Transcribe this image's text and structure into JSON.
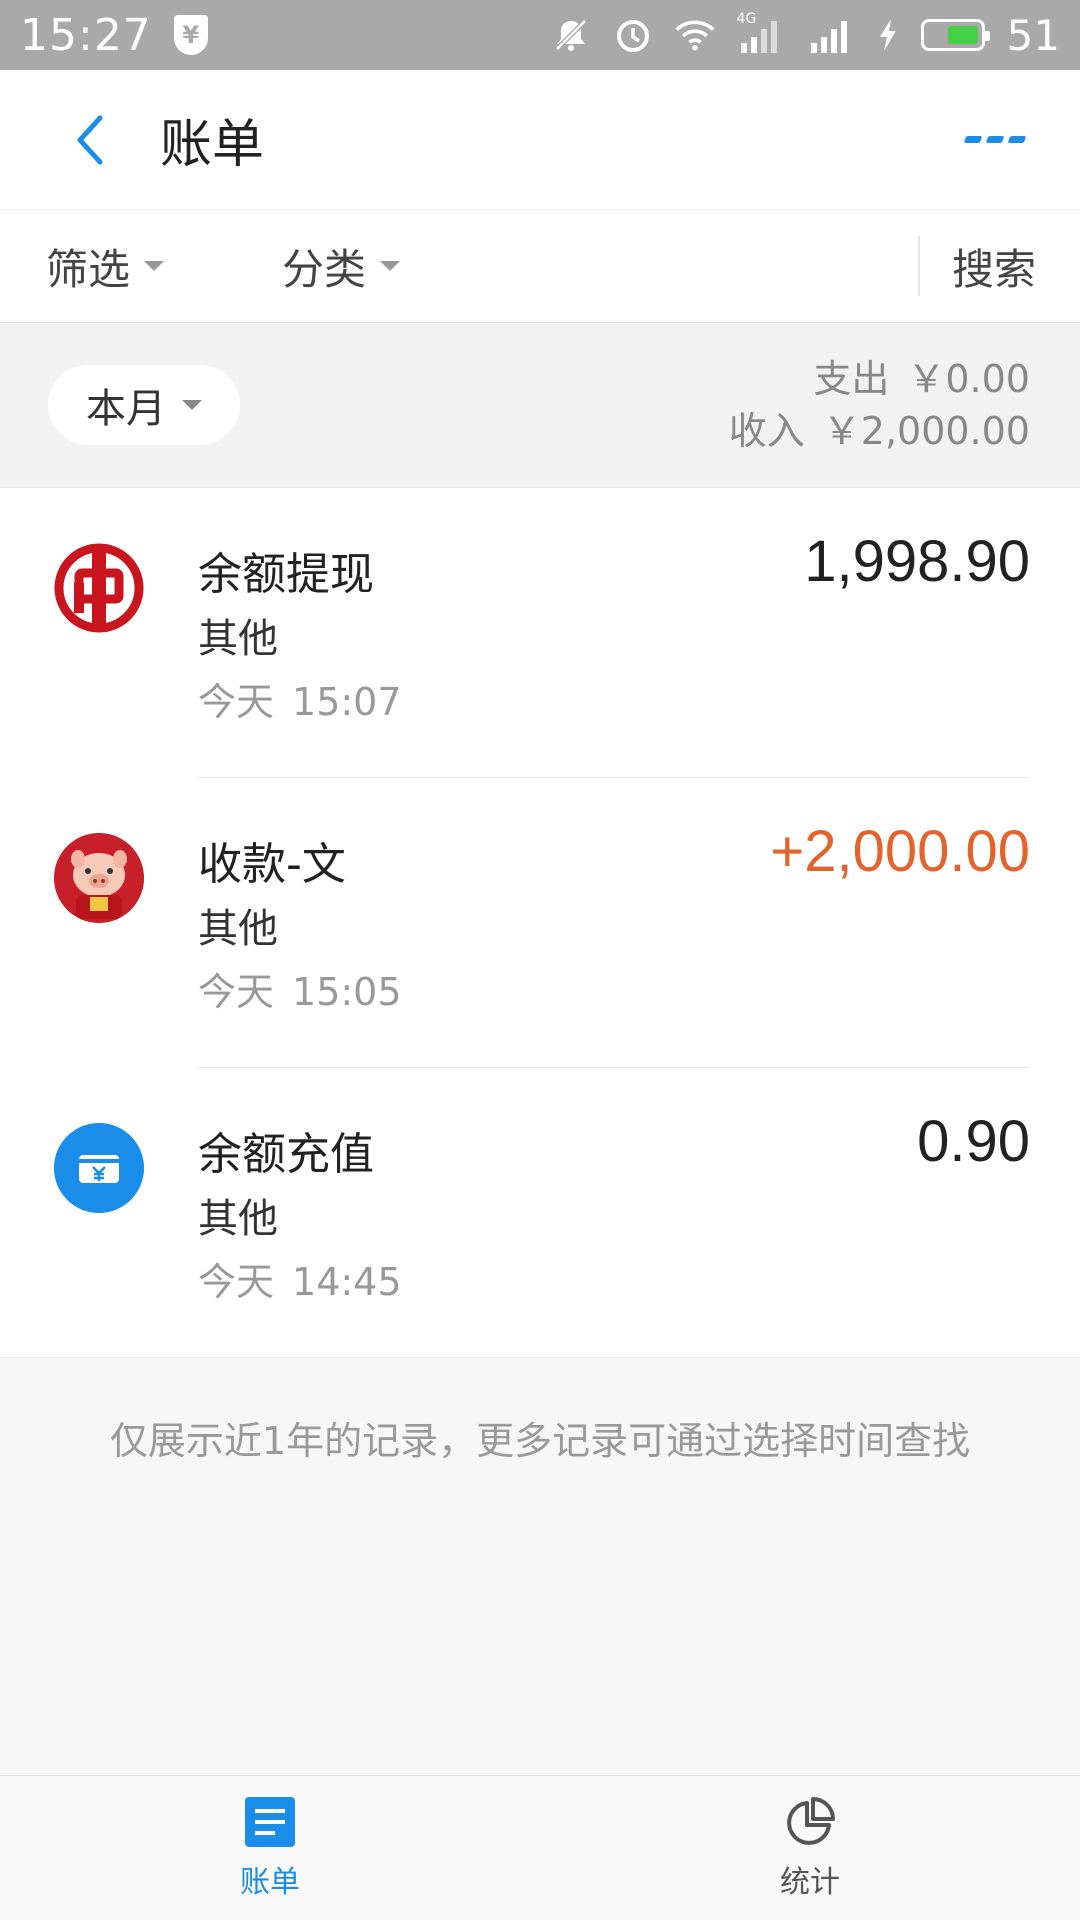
{
  "status_bar": {
    "time": "15:27",
    "shield_glyph": "¥",
    "network_type": "4G",
    "battery_level": "51",
    "icons": [
      "shield-yen-icon",
      "mute-bell-icon",
      "alarm-icon",
      "wifi-icon",
      "signal-4g-icon",
      "signal-icon",
      "charging-icon",
      "battery-icon"
    ]
  },
  "header": {
    "title": "账单",
    "back_icon": "chevron-left-icon",
    "more_icon": "more-dots-icon"
  },
  "filters": {
    "filter_label": "筛选",
    "category_label": "分类",
    "search_label": "搜索"
  },
  "summary": {
    "period": "本月",
    "expense_label": "支出",
    "expense_value": "￥0.00",
    "income_label": "收入",
    "income_value": "￥2,000.00"
  },
  "transactions": [
    {
      "title": "余额提现",
      "category": "其他",
      "date": "今天",
      "time": "15:07",
      "amount": "1,998.90",
      "icon": "bank-logo-icon"
    },
    {
      "title": "收款-文",
      "category": "其他",
      "date": "今天",
      "time": "15:05",
      "amount": "+2,000.00",
      "icon": "pig-avatar-icon"
    },
    {
      "title": "余额充值",
      "category": "其他",
      "date": "今天",
      "time": "14:45",
      "amount": "0.90",
      "icon": "wallet-yen-icon"
    }
  ],
  "notice": "仅展示近1年的记录，更多记录可通过选择时间查找",
  "tabs": [
    {
      "label": "账单",
      "icon": "bill-list-icon",
      "active": true
    },
    {
      "label": "统计",
      "icon": "pie-chart-icon",
      "active": false
    }
  ],
  "colors": {
    "accent": "#1a8de8",
    "income": "#e2632b",
    "bank_red": "#c9151e",
    "status_bar": "#a9a9a9"
  }
}
